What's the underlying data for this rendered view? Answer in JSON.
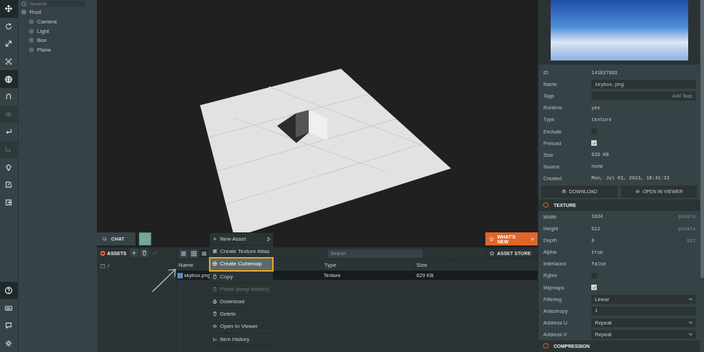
{
  "toolbar": {
    "tools": [
      {
        "selected": true,
        "disabled": false
      },
      {
        "selected": false,
        "disabled": false
      },
      {
        "selected": false,
        "disabled": false
      },
      {
        "selected": false,
        "disabled": false
      },
      {
        "selected": true,
        "disabled": false
      },
      {
        "selected": false,
        "disabled": false
      },
      {
        "selected": false,
        "disabled": true
      },
      {
        "selected": false,
        "disabled": false
      },
      {
        "selected": false,
        "disabled": true
      },
      {
        "selected": false,
        "disabled": false
      },
      {
        "selected": false,
        "disabled": false
      },
      {
        "selected": false,
        "disabled": false
      }
    ],
    "bottom": [
      {
        "selected": true
      },
      {
        "selected": false
      },
      {
        "selected": false
      },
      {
        "selected": false
      }
    ]
  },
  "hierarchy": {
    "search": {
      "placeholder": "Search"
    },
    "tree": [
      {
        "label": "Root",
        "children": [
          {
            "label": "Camera"
          },
          {
            "label": "Light"
          },
          {
            "label": "Box"
          },
          {
            "label": "Plane"
          }
        ]
      }
    ]
  },
  "viewport": {
    "chat": "CHAT",
    "whats_new": "WHAT'S NEW",
    "close": "×"
  },
  "assets": {
    "title": "ASSETS",
    "folder": "/",
    "views": [
      {
        "selected": false
      },
      {
        "selected": false
      },
      {
        "selected": true
      }
    ],
    "search": {
      "placeholder": "Search"
    },
    "store": "ASSET STORE",
    "columns": [
      "Name",
      "Type",
      "Size"
    ],
    "rows": [
      {
        "name": "skybox.png",
        "type": "Texture",
        "size": "629 KB",
        "selected": true
      }
    ]
  },
  "context_menu": [
    {
      "label": "New Asset",
      "submenu": true,
      "disabled": false,
      "selected": false
    },
    {
      "label": "Create Texture Atlas",
      "submenu": false,
      "disabled": false,
      "selected": false
    },
    {
      "label": "Create Cubemap",
      "submenu": false,
      "disabled": false,
      "selected": true
    },
    {
      "label": "Copy",
      "submenu": false,
      "disabled": false,
      "selected": false
    },
    {
      "label": "Paste (keep folders)",
      "submenu": false,
      "disabled": true,
      "selected": false
    },
    {
      "label": "Download",
      "submenu": false,
      "disabled": false,
      "selected": false
    },
    {
      "label": "Delete",
      "submenu": false,
      "disabled": false,
      "selected": false
    },
    {
      "label": "Open In Viewer",
      "submenu": false,
      "disabled": false,
      "selected": false
    },
    {
      "label": "Item History",
      "submenu": false,
      "disabled": false,
      "selected": false
    }
  ],
  "inspector": {
    "rows": [
      {
        "label": "ID",
        "kind": "text",
        "value": "141827693"
      },
      {
        "label": "Name",
        "kind": "input",
        "value": "skybox.png"
      },
      {
        "label": "Tags",
        "kind": "input",
        "placeholder": "Add Tags"
      },
      {
        "label": "Runtime",
        "kind": "text",
        "value": "yes"
      },
      {
        "label": "Type",
        "kind": "text",
        "value": "texture"
      },
      {
        "label": "Exclude",
        "kind": "checkbox",
        "checked": false
      },
      {
        "label": "Preload",
        "kind": "checkbox",
        "checked": true
      },
      {
        "label": "Size",
        "kind": "text",
        "value": "629 KB"
      },
      {
        "label": "Source",
        "kind": "text",
        "value": "none"
      },
      {
        "label": "Created",
        "kind": "text",
        "value": "Mon, Jul 03, 2023, 16:41:33"
      }
    ],
    "buttons": [
      "DOWNLOAD",
      "OPEN IN VIEWER"
    ],
    "sections": [
      {
        "title": "TEXTURE",
        "rows": [
          {
            "label": "Width",
            "kind": "text",
            "value": "1024",
            "unit": "pixels"
          },
          {
            "label": "Height",
            "kind": "text",
            "value": "512",
            "unit": "pixels"
          },
          {
            "label": "Depth",
            "kind": "text",
            "value": "8",
            "unit": "bit"
          },
          {
            "label": "Alpha",
            "kind": "text",
            "value": "true"
          },
          {
            "label": "Interlaced",
            "kind": "text",
            "value": "false"
          },
          {
            "label": "Rgbm",
            "kind": "checkbox",
            "checked": false
          },
          {
            "label": "Mipmaps",
            "kind": "checkbox",
            "checked": true
          },
          {
            "label": "Filtering",
            "kind": "select",
            "value": "Linear"
          },
          {
            "label": "Anisotropy",
            "kind": "input",
            "value": "1"
          },
          {
            "label": "Address U",
            "kind": "select",
            "value": "Repeat"
          },
          {
            "label": "Address V",
            "kind": "select",
            "value": "Repeat"
          }
        ]
      },
      {
        "title": "COMPRESSION"
      }
    ]
  }
}
